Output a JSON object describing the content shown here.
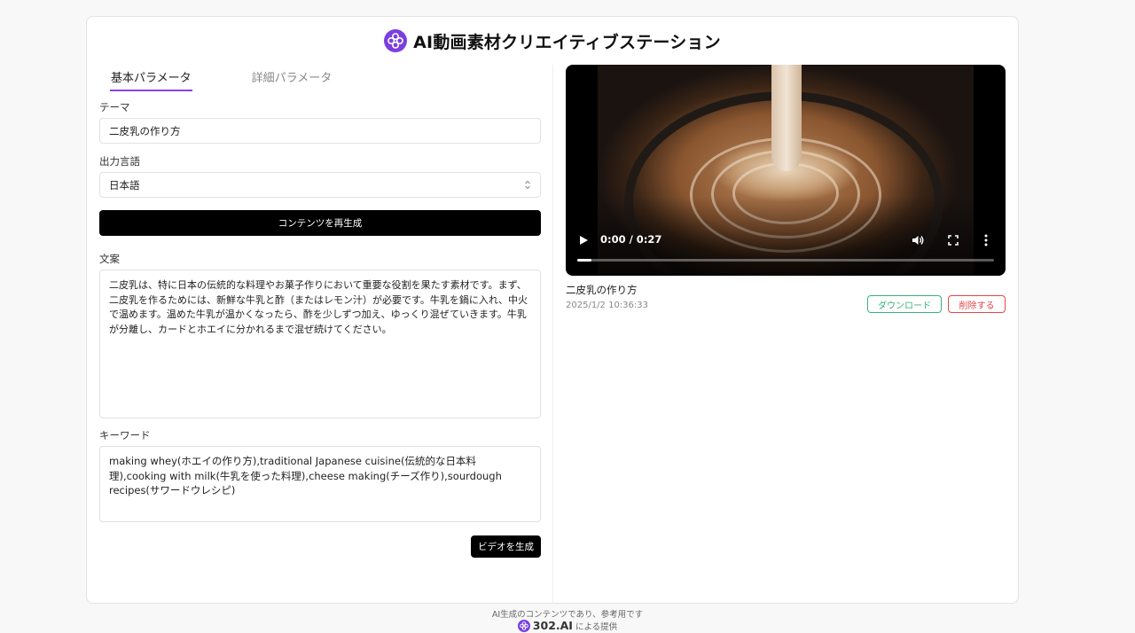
{
  "header": {
    "title": "AI動画素材クリエイティブステーション"
  },
  "tabs": [
    {
      "label": "基本パラメータ",
      "active": true
    },
    {
      "label": "詳細パラメータ",
      "active": false
    }
  ],
  "form": {
    "theme_label": "テーマ",
    "theme_value": "二皮乳の作り方",
    "language_label": "出力言語",
    "language_value": "日本語",
    "regenerate_button": "コンテンツを再生成",
    "script_label": "文案",
    "script_value": "二皮乳は、特に日本の伝統的な料理やお菓子作りにおいて重要な役割を果たす素材です。まず、二皮乳を作るためには、新鮮な牛乳と酢（またはレモン汁）が必要です。牛乳を鍋に入れ、中火で温めます。温めた牛乳が温かくなったら、酢を少しずつ加え、ゆっくり混ぜていきます。牛乳が分離し、カードとホエイに分かれるまで混ぜ続けてください。",
    "keywords_label": "キーワード",
    "keywords_value": "making whey(ホエイの作り方),traditional Japanese cuisine(伝統的な日本料理),cooking with milk(牛乳を使った料理),cheese making(チーズ作り),sourdough recipes(サワードウレシピ)",
    "generate_button": "ビデオを生成"
  },
  "video": {
    "time": "0:00 / 0:27",
    "progress": 0.035,
    "title": "二皮乳の作り方",
    "date": "2025/1/2 10:36:33",
    "download_button": "ダウンロード",
    "delete_button": "削除する"
  },
  "footer": {
    "disclaimer": "AI生成のコンテンツであり、参考用です",
    "brand": "302.AI",
    "provided_by": "による提供"
  },
  "colors": {
    "accent": "#8b3ff0",
    "download": "#36b27a",
    "delete": "#e24848",
    "button_black": "#000000"
  },
  "icons": [
    "app-logo-icon",
    "chevron-updown-icon",
    "play-icon",
    "volume-icon",
    "fullscreen-icon",
    "more-vertical-icon"
  ]
}
